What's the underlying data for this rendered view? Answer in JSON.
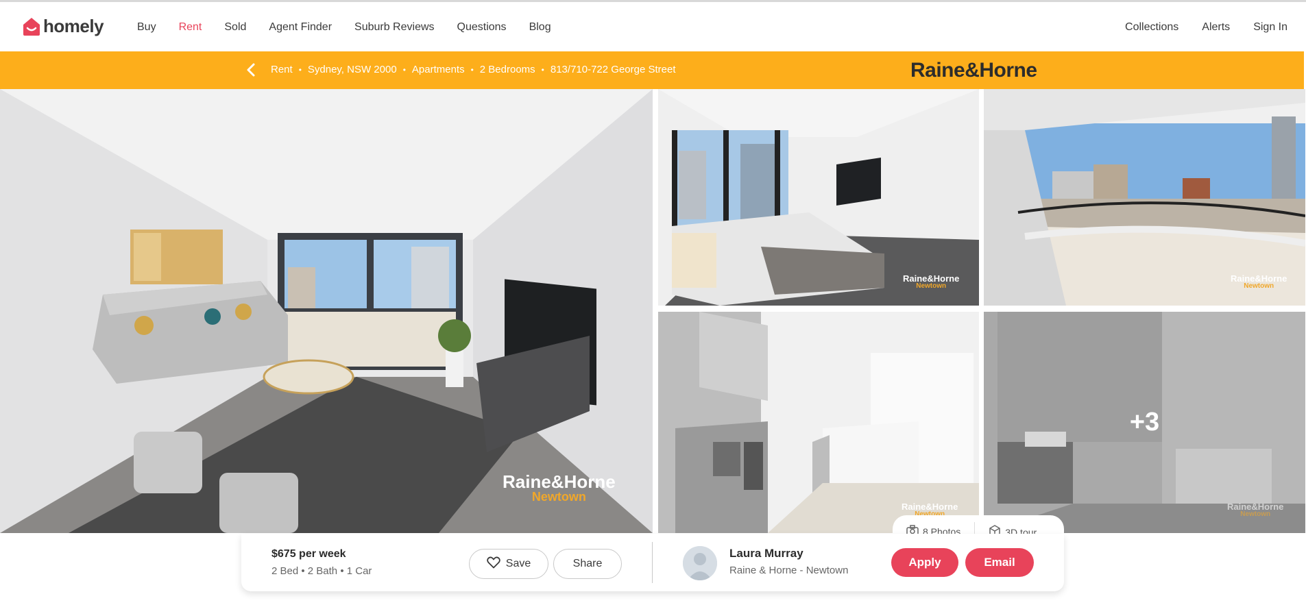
{
  "header": {
    "logo_text": "homely",
    "nav": [
      {
        "label": "Buy",
        "active": false
      },
      {
        "label": "Rent",
        "active": true
      },
      {
        "label": "Sold",
        "active": false
      },
      {
        "label": "Agent Finder",
        "active": false
      },
      {
        "label": "Suburb Reviews",
        "active": false
      },
      {
        "label": "Questions",
        "active": false
      },
      {
        "label": "Blog",
        "active": false
      }
    ],
    "nav_right": [
      "Collections",
      "Alerts",
      "Sign In"
    ]
  },
  "breadcrumb": {
    "items": [
      "Rent",
      "Sydney, NSW 2000",
      "Apartments",
      "2 Bedrooms",
      "813/710-722 George Street"
    ],
    "separator": "•"
  },
  "agency_logo": "Raine&Horne",
  "gallery": {
    "watermark_brand": "Raine&Horne",
    "watermark_office": "Newtown",
    "more_photos_label": "+3",
    "photos_label": "8 Photos",
    "tour_label": "3D tour"
  },
  "listing": {
    "price": "$675 per week",
    "specs": "2 Bed • 2 Bath • 1 Car",
    "save_label": "Save",
    "share_label": "Share"
  },
  "agent": {
    "name": "Laura Murray",
    "agency": "Raine & Horne - Newtown",
    "apply_label": "Apply",
    "email_label": "Email"
  },
  "colors": {
    "brand_red": "#e8435a",
    "agency_yellow": "#fdae1b",
    "watermark_orange": "#f0a72a"
  },
  "icons": [
    "homely-house-icon",
    "chevron-left-icon",
    "heart-icon",
    "camera-icon",
    "cube-icon",
    "avatar-placeholder-icon"
  ]
}
